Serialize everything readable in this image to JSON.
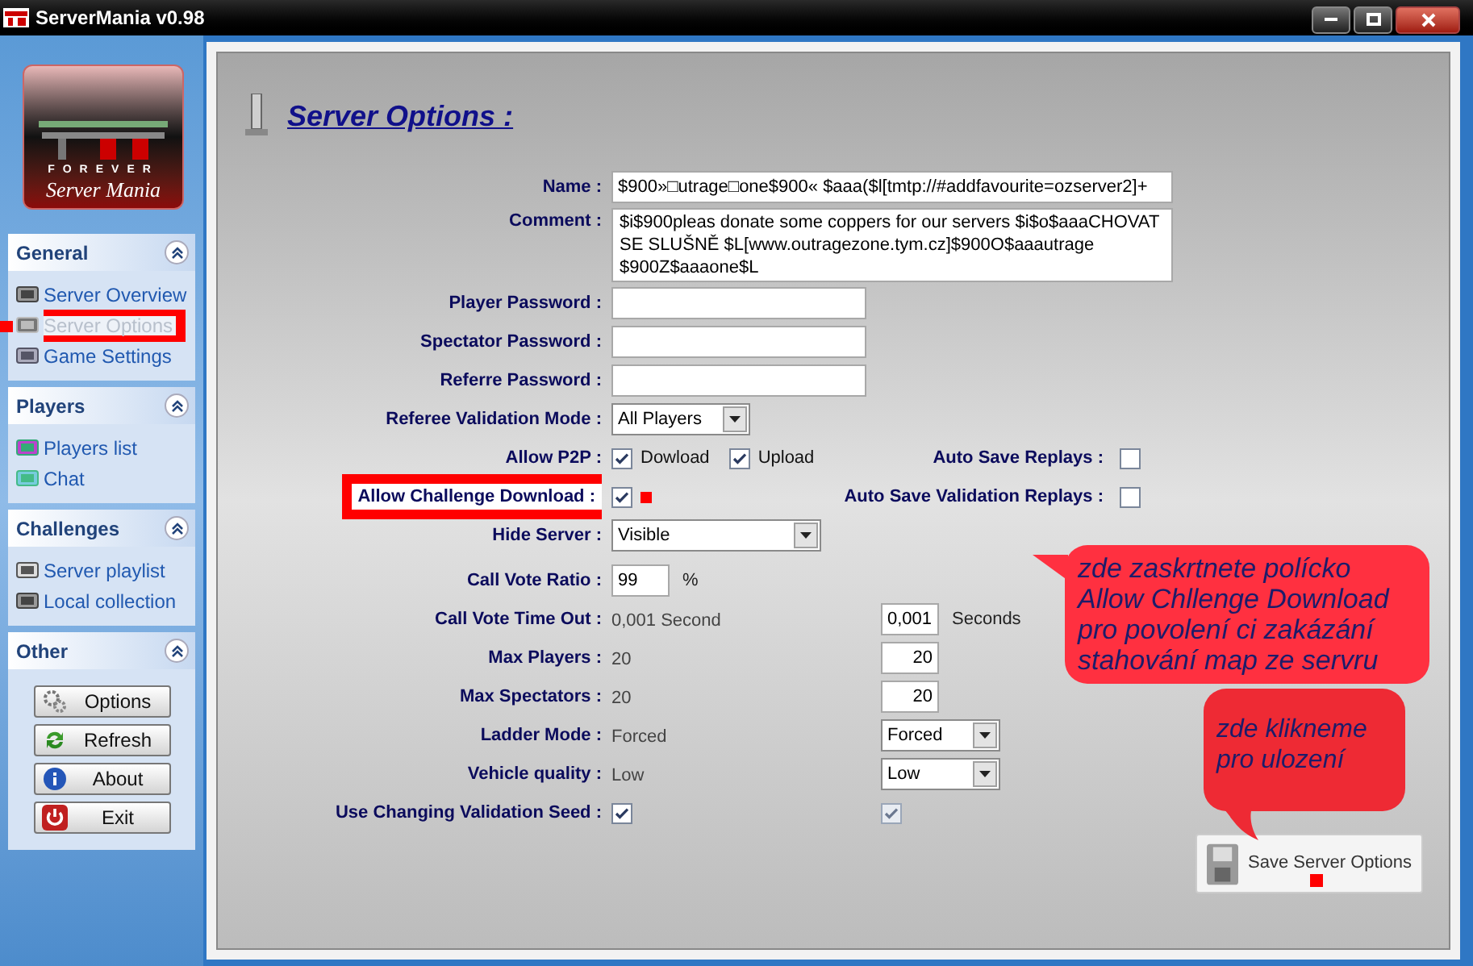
{
  "window": {
    "title": "ServerMania v0.98"
  },
  "logo": {
    "word": "FOREVER",
    "name": "Server Mania"
  },
  "sidebar": {
    "sections": [
      {
        "title": "General",
        "expanded": true,
        "items": [
          {
            "label": "Server Overview",
            "selected": false,
            "annotated": false
          },
          {
            "label": "Server Options",
            "selected": true,
            "annotated": true
          },
          {
            "label": "Game Settings",
            "selected": false,
            "annotated": false
          }
        ]
      },
      {
        "title": "Players",
        "expanded": true,
        "items": [
          {
            "label": "Players list",
            "selected": false,
            "annotated": false
          },
          {
            "label": "Chat",
            "selected": false,
            "annotated": false
          }
        ]
      },
      {
        "title": "Challenges",
        "expanded": true,
        "items": [
          {
            "label": "Server playlist",
            "selected": false,
            "annotated": false
          },
          {
            "label": "Local collection",
            "selected": false,
            "annotated": false
          }
        ]
      },
      {
        "title": "Other",
        "expanded": true,
        "buttons": [
          "Options",
          "Refresh",
          "About",
          "Exit"
        ]
      }
    ]
  },
  "page": {
    "title": "Server Options :"
  },
  "form": {
    "rows": [
      {
        "kind": "text",
        "label": "Name :",
        "value": "$900»□utrage□one$900« $aaa($l[tmtp://#addfavourite=ozserver2]+"
      },
      {
        "kind": "textarea",
        "label": "Comment :",
        "value": "$i$900pleas donate some coppers for our servers $i$o$aaaCHOVAT SE SLUŠNĚ $L[www.outragezone.tym.cz]$900O$aaautrage $900Z$aaaone$L"
      },
      {
        "kind": "text",
        "label": "Player Password :"
      },
      {
        "kind": "text",
        "label": "Spectator Password :"
      },
      {
        "kind": "text",
        "label": "Referre Password :"
      },
      {
        "kind": "select",
        "label": "Referee Validation Mode :",
        "value": "All Players"
      },
      {
        "kind": "checks",
        "label": "Allow P2P :",
        "options": [
          {
            "label": "Dowload",
            "checked": true
          },
          {
            "label": "Upload",
            "checked": true
          }
        ],
        "extra": {
          "label": "Auto Save Replays :",
          "checked": false
        }
      },
      {
        "kind": "checks",
        "label": "Allow Challenge Download :",
        "annotated": true,
        "options": [
          {
            "checked": true
          }
        ],
        "extra": {
          "label": "Auto Save Validation Replays :",
          "checked": false
        }
      },
      {
        "kind": "dropdown",
        "label": "Hide Server :",
        "value": "Visible"
      },
      {
        "kind": "pair",
        "label": "Call Vote Ratio :",
        "current": {
          "kind": "input",
          "value": "99",
          "unit": "%"
        }
      },
      {
        "kind": "pair",
        "label": "Call Vote Time Out :",
        "current": {
          "kind": "text",
          "value": "0,001 Second"
        },
        "setting": {
          "kind": "input",
          "value": "0,001",
          "unit": "Seconds"
        }
      },
      {
        "kind": "pair",
        "label": "Max Players :",
        "current": {
          "kind": "text",
          "value": "20"
        },
        "setting": {
          "kind": "input",
          "value": "20"
        }
      },
      {
        "kind": "pair",
        "label": "Max Spectators :",
        "current": {
          "kind": "text",
          "value": "20"
        },
        "setting": {
          "kind": "input",
          "value": "20"
        }
      },
      {
        "kind": "pair",
        "label": "Ladder Mode :",
        "current": {
          "kind": "text",
          "value": "Forced"
        },
        "setting": {
          "kind": "select",
          "value": "Forced"
        }
      },
      {
        "kind": "pair",
        "label": "Vehicle quality :",
        "current": {
          "kind": "text",
          "value": "Low"
        },
        "setting": {
          "kind": "select",
          "value": "Low"
        }
      },
      {
        "kind": "pair",
        "label": "Use Changing Validation Seed :",
        "current": {
          "kind": "check",
          "checked": true
        },
        "setting": {
          "kind": "check",
          "checked": true
        }
      }
    ]
  },
  "save_button": {
    "label": "Save Server Options",
    "annotated": true
  },
  "callouts": [
    {
      "lines": [
        "zde zaskrtnete polícko",
        "Allow Chllenge Download",
        "pro povolení ci zakázání",
        "stahování map ze servru"
      ]
    },
    {
      "lines": [
        "zde klikneme",
        "pro ulození"
      ]
    }
  ]
}
